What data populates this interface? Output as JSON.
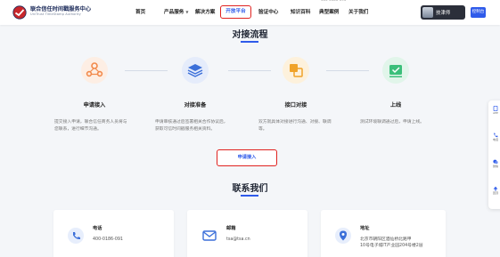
{
  "header": {
    "brand_name": "联合信任时间戳服务中心",
    "brand_sub": "UniTrust TimeStamp Authority",
    "top_cut": "400-0186-091",
    "nav": [
      {
        "label": "首页"
      },
      {
        "label": "产品服务"
      },
      {
        "label": "解决方案"
      },
      {
        "label": "开放平台"
      },
      {
        "label": "验证中心"
      },
      {
        "label": "知识百科"
      },
      {
        "label": "典型案例"
      },
      {
        "label": "关于我们"
      }
    ],
    "user_name": "技津师",
    "action_label": "控制台"
  },
  "flow": {
    "title": "对接流程",
    "steps": [
      {
        "name": "申请接入",
        "desc": "提交接入申请，联合信任商务人员将与您联系，进行细节沟通。",
        "icon": "user-network-icon"
      },
      {
        "name": "对接准备",
        "desc": "申请审核通过后签署相关合作协议后，获取可信时间戳服务相关资料。",
        "icon": "layers-icon"
      },
      {
        "name": "接口对接",
        "desc": "双方就具体对接进行沟通、对接、联调等。",
        "icon": "interface-icon"
      },
      {
        "name": "上线",
        "desc": "测试环境联调通过后，申请上线。",
        "icon": "check-icon"
      }
    ],
    "apply_label": "申请接入"
  },
  "contact": {
    "title": "联系我们",
    "cards": [
      {
        "label": "电话",
        "value": "400-0186-091",
        "icon": "phone-icon"
      },
      {
        "label": "邮箱",
        "value": "tsa@tsa.cn",
        "icon": "mail-icon"
      },
      {
        "label": "地址",
        "value": "北京市朝阳区酒仙桥北路甲",
        "value2": "10号电子城IT产业园204号楼2层",
        "icon": "location-icon"
      }
    ]
  },
  "side": [
    {
      "label": "APP",
      "icon": "app-icon"
    },
    {
      "label": "电话",
      "icon": "phone-icon"
    },
    {
      "label": "微信",
      "icon": "wechat-icon"
    },
    {
      "label": "回顶",
      "icon": "top-icon"
    }
  ],
  "colors": {
    "accent": "#2f5bea",
    "highlight": "#e0221f",
    "step1": "#f2894a",
    "step2": "#3b6fd9",
    "step3": "#f0a32a",
    "step4": "#3bbf7a"
  }
}
